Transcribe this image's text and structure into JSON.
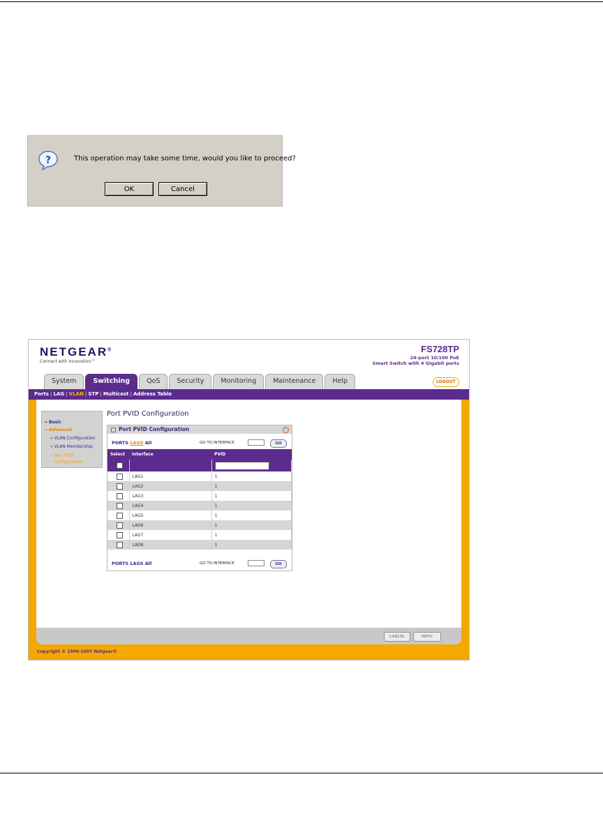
{
  "dialog": {
    "message": "This operation may take some time, would you like to proceed?",
    "ok_label": "OK",
    "cancel_label": "Cancel",
    "icon": "question-icon"
  },
  "header": {
    "logo": "NETGEAR",
    "logo_mark": "®",
    "tagline": "Connect with Innovation™",
    "model": "FS728TP",
    "model_line1": "24-port 10/100 PoE",
    "model_line2": "Smart Switch with 4 Gigabit ports",
    "logout_label": "LOGOUT"
  },
  "tabs": [
    {
      "label": "System",
      "active": false
    },
    {
      "label": "Switching",
      "active": true
    },
    {
      "label": "QoS",
      "active": false
    },
    {
      "label": "Security",
      "active": false
    },
    {
      "label": "Monitoring",
      "active": false
    },
    {
      "label": "Maintenance",
      "active": false
    },
    {
      "label": "Help",
      "active": false
    }
  ],
  "subnav": {
    "items": [
      "Ports",
      "LAG",
      "VLAN",
      "STP",
      "Multicast",
      "Address Table"
    ],
    "current": "VLAN"
  },
  "sidemenu": {
    "basic": "» Basic",
    "advanced": "» Advanced",
    "items": [
      "» VLAN Configuration",
      "» VLAN Membership"
    ],
    "active_line1": "» Port PVID",
    "active_line2": "Configuration"
  },
  "main": {
    "page_title": "Port PVID Configuration",
    "panel_title": "Port PVID Configuration",
    "filter": {
      "ports": "PORTS",
      "lags": "LAGS",
      "all": "All"
    },
    "goto_label": "GO TO INTERFACE",
    "go_label": "GO",
    "columns": [
      "Select",
      "Interface",
      "PVID"
    ],
    "rows": [
      {
        "interface": "LAG1",
        "pvid": "1"
      },
      {
        "interface": "LAG2",
        "pvid": "1"
      },
      {
        "interface": "LAG3",
        "pvid": "1"
      },
      {
        "interface": "LAG4",
        "pvid": "1"
      },
      {
        "interface": "LAG5",
        "pvid": "1"
      },
      {
        "interface": "LAG6",
        "pvid": "1"
      },
      {
        "interface": "LAG7",
        "pvid": "1"
      },
      {
        "interface": "LAG8",
        "pvid": "1"
      }
    ]
  },
  "footer": {
    "cancel_label": "CANCEL",
    "apply_label": "APPLY",
    "copyright": "Copyright © 1996-2007 Netgear®"
  },
  "colors": {
    "brand_purple": "#5c2b8e",
    "brand_orange": "#f5a800"
  }
}
